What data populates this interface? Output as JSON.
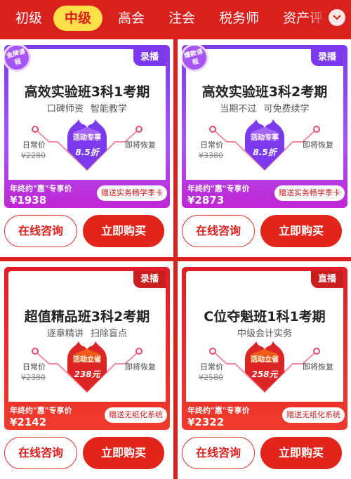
{
  "tabs": {
    "items": [
      "初级",
      "中级",
      "高会",
      "注会",
      "税务师",
      "资产评"
    ],
    "active_index": 1,
    "more_icon": "chevron-down-icon"
  },
  "colors": {
    "page_bg": "#d8201d",
    "active_tab_bg": "#fde047",
    "purple_card": "#8b5cf6",
    "red_card": "#e11d27",
    "buy_button": "#e1251b"
  },
  "common": {
    "daily_label": "日常价",
    "restore_label": "即将恢复",
    "promo_label": "年终约\"惠\"专享价",
    "consult_label": "在线咨询",
    "buy_label": "立即购买"
  },
  "products": [
    {
      "style": "purple",
      "badge": "金牌课程",
      "tag": "录播",
      "title": "高效实验班3科1考期",
      "subtitle": "口碑师资  智能教学",
      "original_price": "¥2280",
      "burst_label": "活动专享",
      "burst_value": "8.5折",
      "promo_price": "¥1938",
      "gift": "赠送实务畅学季卡"
    },
    {
      "style": "purple",
      "badge": "爆款课程",
      "tag": "录播",
      "title": "高效实验班3科2考期",
      "subtitle": "当期不过  可免费续学",
      "original_price": "¥3380",
      "burst_label": "活动专享",
      "burst_value": "8.5折",
      "promo_price": "¥2873",
      "gift": "赠送实务畅学季卡"
    },
    {
      "style": "red",
      "badge": "",
      "tag": "录播",
      "title": "超值精品班3科2考期",
      "subtitle": "逐章精讲  扫除盲点",
      "original_price": "¥2380",
      "burst_label": "活动立省",
      "burst_value": "238元",
      "promo_price": "¥2142",
      "gift": "赠送无纸化系统"
    },
    {
      "style": "red",
      "badge": "",
      "tag": "直播",
      "title": "C位夺魁班1科1考期",
      "subtitle": "中级会计实务",
      "original_price": "¥2580",
      "burst_label": "活动立省",
      "burst_value": "258元",
      "promo_price": "¥2322",
      "gift": "赠送无纸化系统"
    }
  ]
}
